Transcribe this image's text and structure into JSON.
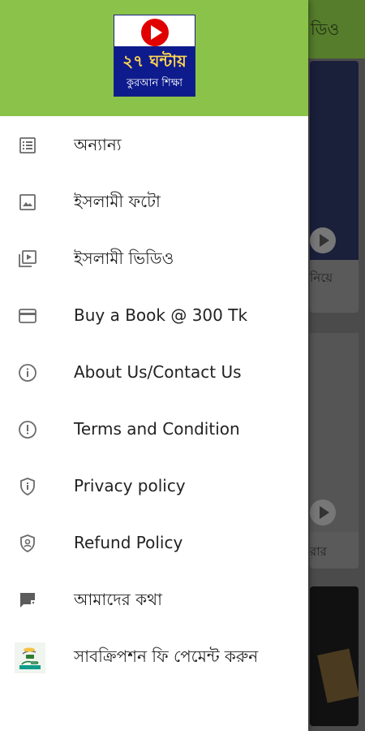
{
  "logo": {
    "line1": "২৭ ঘন্টায়",
    "line2": "কুরআন শিক্ষা"
  },
  "drawer": {
    "items": [
      {
        "label": "অন্যান্য",
        "icon": "list-icon"
      },
      {
        "label": "ইসলামী ফটো",
        "icon": "image-icon"
      },
      {
        "label": "ইসলামী ভিডিও",
        "icon": "video-library-icon"
      },
      {
        "label": "Buy a Book @ 300 Tk",
        "icon": "credit-card-icon"
      },
      {
        "label": "About Us/Contact Us",
        "icon": "info-icon"
      },
      {
        "label": "Terms and Condition",
        "icon": "alert-circle-icon"
      },
      {
        "label": "Privacy policy",
        "icon": "shield-info-icon"
      },
      {
        "label": "Refund Policy",
        "icon": "shield-person-icon"
      },
      {
        "label": "আমাদের কথা",
        "icon": "feedback-icon"
      },
      {
        "label": "সাবক্রিপশন ফি পেমেন্ট করুন",
        "icon": "payment-hand-icon"
      }
    ]
  },
  "background": {
    "header_title": "ডিও",
    "card1_caption": "নিয়ে",
    "card2_caption": "রার"
  },
  "colors": {
    "header_green": "#8bc34a",
    "logo_blue": "#0d1b8c",
    "logo_red": "#e00000"
  }
}
